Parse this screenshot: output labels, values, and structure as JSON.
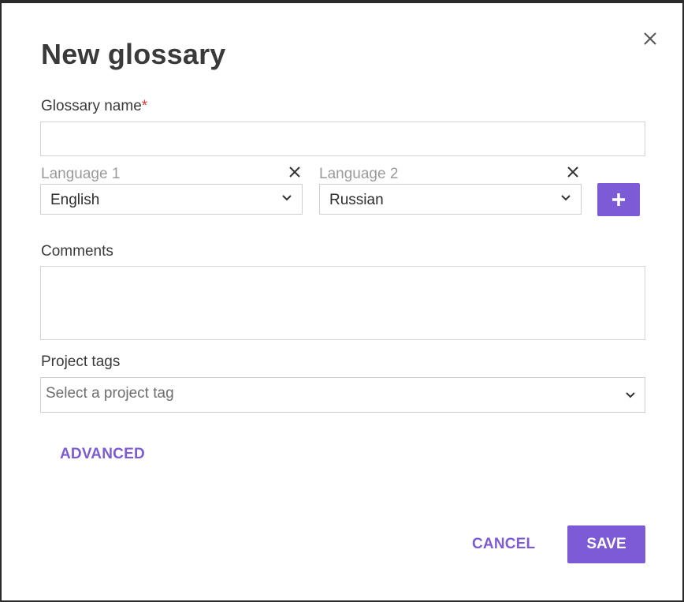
{
  "dialog": {
    "title": "New glossary",
    "close_icon": "close-icon"
  },
  "glossary_name": {
    "label": "Glossary name",
    "required_marker": "*",
    "value": "",
    "placeholder": ""
  },
  "languages": [
    {
      "label": "Language 1",
      "selected": "English",
      "remove_icon": "close-icon"
    },
    {
      "label": "Language 2",
      "selected": "Russian",
      "remove_icon": "close-icon"
    }
  ],
  "add_language": {
    "icon": "plus-icon"
  },
  "comments": {
    "label": "Comments",
    "value": ""
  },
  "project_tags": {
    "label": "Project tags",
    "placeholder": "Select a project tag"
  },
  "advanced_label": "ADVANCED",
  "actions": {
    "cancel_label": "CANCEL",
    "save_label": "SAVE"
  },
  "colors": {
    "accent": "#7e5bd6",
    "required": "#e53935",
    "text": "#3a3a3a"
  }
}
